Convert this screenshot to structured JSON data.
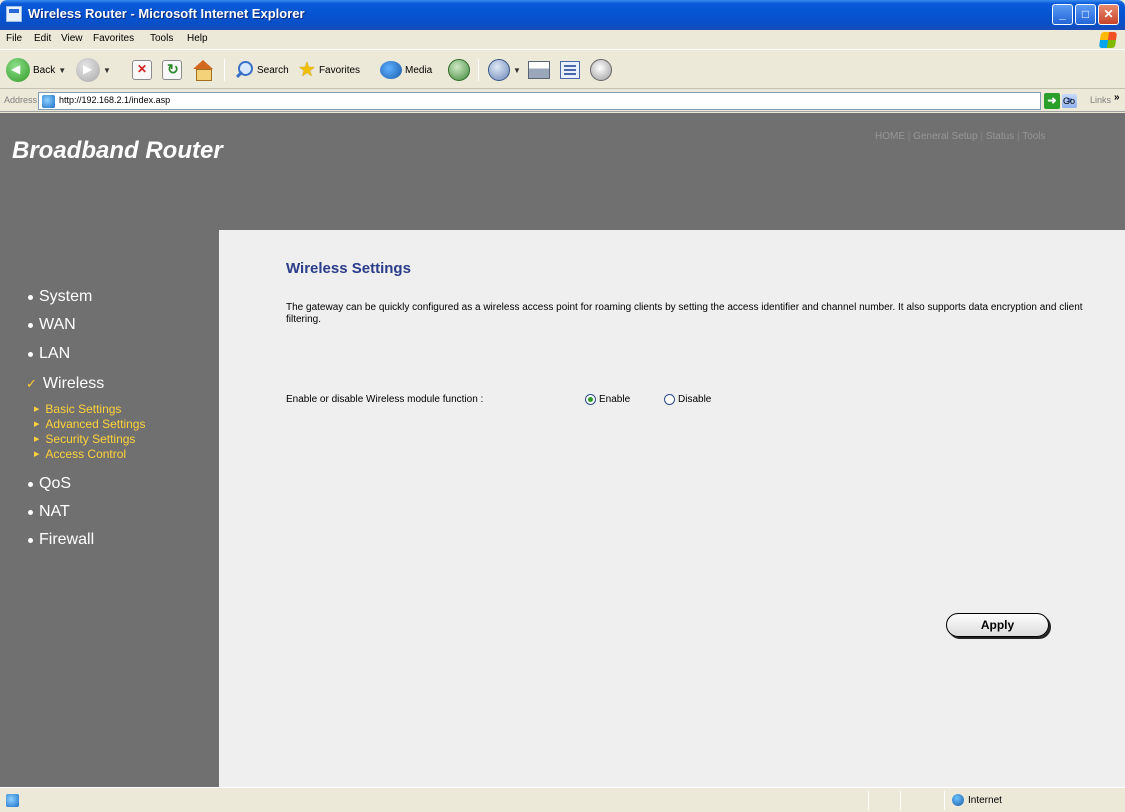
{
  "window": {
    "title": "Wireless Router - Microsoft Internet Explorer"
  },
  "menubar": {
    "items": [
      "File",
      "Edit",
      "View",
      "Favorites",
      "Tools",
      "Help"
    ]
  },
  "toolbar": {
    "back_label": "Back",
    "search_label": "Search",
    "favorites_label": "Favorites",
    "media_label": "Media"
  },
  "address": {
    "label": "Address",
    "url": "http://192.168.2.1/index.asp",
    "go_label": "Go",
    "links_label": "Links"
  },
  "header": {
    "title": "Broadband Router",
    "nav": [
      "HOME",
      "General Setup",
      "Status",
      "Tools"
    ]
  },
  "sidebar": {
    "items": [
      {
        "label": "System",
        "marker": "bullet"
      },
      {
        "label": "WAN",
        "marker": "bullet"
      },
      {
        "label": "LAN",
        "marker": "bullet"
      },
      {
        "label": "Wireless",
        "marker": "check"
      },
      {
        "label": "QoS",
        "marker": "bullet"
      },
      {
        "label": "NAT",
        "marker": "bullet"
      },
      {
        "label": "Firewall",
        "marker": "bullet"
      }
    ],
    "sub_items": [
      "Basic Settings",
      "Advanced Settings",
      "Security Settings",
      "Access Control"
    ]
  },
  "main": {
    "title": "Wireless Settings",
    "description": "The gateway can be quickly configured as a wireless access point for roaming clients by setting the access identifier and channel number. It also supports data encryption and client filtering.",
    "wireless_label": "Enable or disable Wireless module function :",
    "options": {
      "enable": "Enable",
      "disable": "Disable",
      "selected": "Enable"
    },
    "apply_label": "Apply"
  },
  "statusbar": {
    "zone": "Internet"
  },
  "colors": {
    "header_bg": "#707070",
    "content_bg": "#efefef",
    "title_color": "#2b3c8a",
    "submenu_color": "#ffd23a"
  }
}
